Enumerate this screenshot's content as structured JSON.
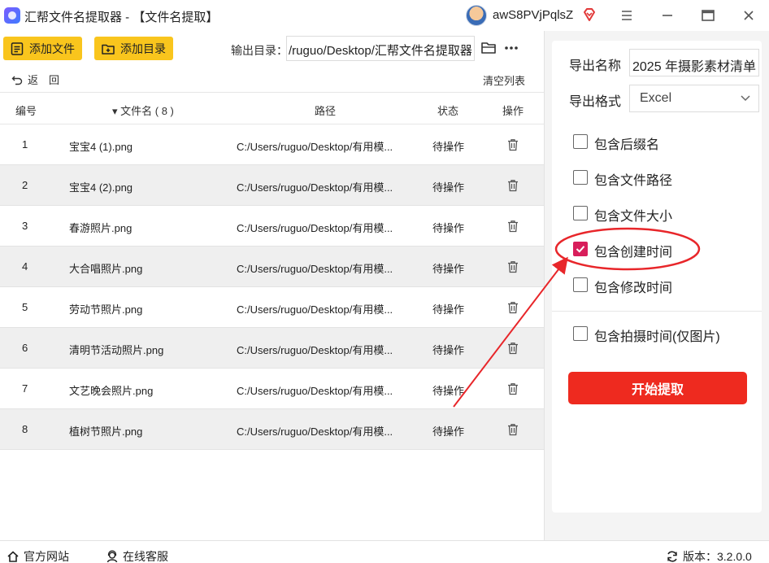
{
  "window": {
    "title": "汇帮文件名提取器 - 【文件名提取】",
    "user_name": "awS8PVjPqlsZ"
  },
  "toolbar": {
    "add_file_label": "添加文件",
    "add_dir_label": "添加目录",
    "output_label": "输出目录：",
    "output_value": "/ruguo/Desktop/汇帮文件名提取器"
  },
  "nav": {
    "back_label": "返　回",
    "clear_label": "清空列表"
  },
  "table": {
    "headers": {
      "index": "编号",
      "filename": "▾ 文件名 ( 8 )",
      "path": "路径",
      "status": "状态",
      "action": "操作"
    },
    "rows": [
      {
        "index": "1",
        "name": "宝宝4 (1).png",
        "path": "C:/Users/ruguo/Desktop/有用模...",
        "status": "待操作"
      },
      {
        "index": "2",
        "name": "宝宝4 (2).png",
        "path": "C:/Users/ruguo/Desktop/有用模...",
        "status": "待操作"
      },
      {
        "index": "3",
        "name": "春游照片.png",
        "path": "C:/Users/ruguo/Desktop/有用模...",
        "status": "待操作"
      },
      {
        "index": "4",
        "name": "大合唱照片.png",
        "path": "C:/Users/ruguo/Desktop/有用模...",
        "status": "待操作"
      },
      {
        "index": "5",
        "name": "劳动节照片.png",
        "path": "C:/Users/ruguo/Desktop/有用模...",
        "status": "待操作"
      },
      {
        "index": "6",
        "name": "清明节活动照片.png",
        "path": "C:/Users/ruguo/Desktop/有用模...",
        "status": "待操作"
      },
      {
        "index": "7",
        "name": "文艺晚会照片.png",
        "path": "C:/Users/ruguo/Desktop/有用模...",
        "status": "待操作"
      },
      {
        "index": "8",
        "name": "植树节照片.png",
        "path": "C:/Users/ruguo/Desktop/有用模...",
        "status": "待操作"
      }
    ]
  },
  "settings": {
    "export_name_label": "导出名称",
    "export_name_value": "2025 年摄影素材清单",
    "export_format_label": "导出格式",
    "export_format_value": "Excel",
    "options": [
      {
        "label": "包含后缀名",
        "checked": false
      },
      {
        "label": "包含文件路径",
        "checked": false
      },
      {
        "label": "包含文件大小",
        "checked": false
      },
      {
        "label": "包含创建时间",
        "checked": true
      },
      {
        "label": "包含修改时间",
        "checked": false
      },
      {
        "label": "包含拍摄时间(仅图片)",
        "checked": false
      }
    ],
    "start_label": "开始提取"
  },
  "footer": {
    "website_label": "官方网站",
    "support_label": "在线客服",
    "version_label": "版本：3.2.0.0"
  },
  "colors": {
    "accent_yellow": "#f9c51d",
    "start_red": "#ee2a1f",
    "check_pink": "#d81e5b",
    "annotation_red": "#e8262a"
  }
}
